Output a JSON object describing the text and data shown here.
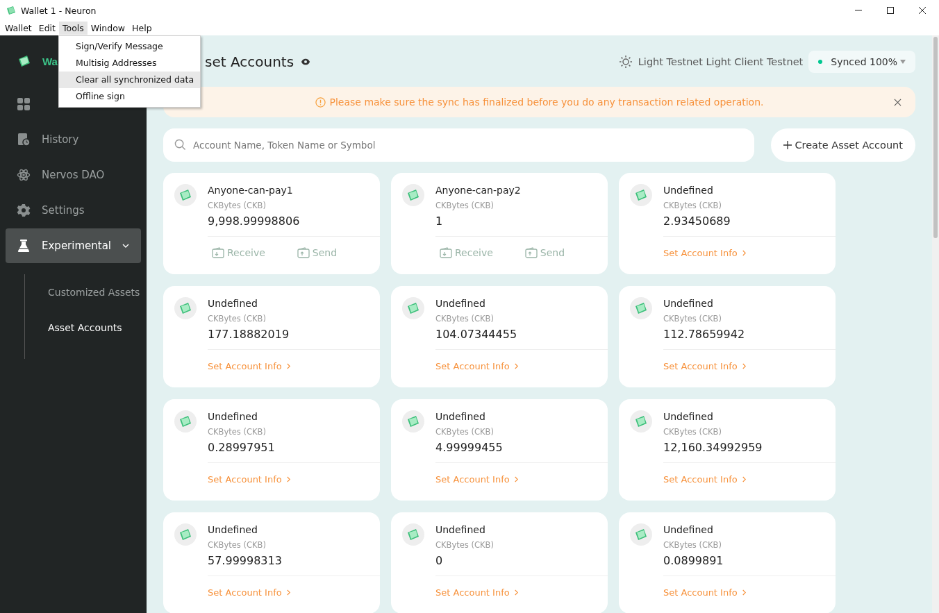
{
  "window": {
    "title": "Wallet 1 - Neuron"
  },
  "menu_bar": [
    {
      "label": "Wallet",
      "selected": false
    },
    {
      "label": "Edit",
      "selected": false
    },
    {
      "label": "Tools",
      "selected": true
    },
    {
      "label": "Window",
      "selected": false
    },
    {
      "label": "Help",
      "selected": false
    }
  ],
  "tools_menu": [
    {
      "label": "Sign/Verify Message",
      "selected": false
    },
    {
      "label": "Multisig Addresses",
      "selected": false
    },
    {
      "label": "Clear all synchronized data",
      "selected": true
    },
    {
      "label": "Offline sign",
      "selected": false
    }
  ],
  "sidebar": {
    "wallet_name": "Wa",
    "items": [
      {
        "selected": false
      },
      {
        "label": "History",
        "selected": false
      },
      {
        "label": "Nervos DAO",
        "selected": false
      },
      {
        "label": "Settings",
        "selected": false
      },
      {
        "label": "Experimental",
        "selected": true,
        "expanded": true,
        "children": [
          {
            "label": "Customized Assets",
            "selected": false
          },
          {
            "label": "Asset Accounts",
            "selected": true
          }
        ]
      }
    ]
  },
  "header": {
    "title": "set Accounts",
    "network": "Light Testnet Light Client Testnet",
    "sync": "Synced 100%"
  },
  "banner": {
    "message": "Please make sure the sync has finalized before you do any transaction related operation."
  },
  "search": {
    "placeholder": "Account Name, Token Name or Symbol"
  },
  "create_button": "Create Asset Account",
  "accounts": [
    {
      "kind": "acp",
      "name": "Anyone-can-pay1",
      "token": "CKBytes (CKB)",
      "balance": "9,998.99998806",
      "actions": [
        "Receive",
        "Send"
      ]
    },
    {
      "kind": "acp",
      "name": "Anyone-can-pay2",
      "token": "CKBytes (CKB)",
      "balance": "1",
      "actions": [
        "Receive",
        "Send"
      ]
    },
    {
      "kind": "plain",
      "name": "Undefined",
      "token": "CKBytes (CKB)",
      "balance": "2.93450689",
      "link": "Set Account Info"
    },
    {
      "kind": "plain",
      "name": "Undefined",
      "token": "CKBytes (CKB)",
      "balance": "177.18882019",
      "link": "Set Account Info"
    },
    {
      "kind": "plain",
      "name": "Undefined",
      "token": "CKBytes (CKB)",
      "balance": "104.07344455",
      "link": "Set Account Info"
    },
    {
      "kind": "plain",
      "name": "Undefined",
      "token": "CKBytes (CKB)",
      "balance": "112.78659942",
      "link": "Set Account Info"
    },
    {
      "kind": "plain",
      "name": "Undefined",
      "token": "CKBytes (CKB)",
      "balance": "0.28997951",
      "link": "Set Account Info"
    },
    {
      "kind": "plain",
      "name": "Undefined",
      "token": "CKBytes (CKB)",
      "balance": "4.99999455",
      "link": "Set Account Info"
    },
    {
      "kind": "plain",
      "name": "Undefined",
      "token": "CKBytes (CKB)",
      "balance": "12,160.34992959",
      "link": "Set Account Info"
    },
    {
      "kind": "plain",
      "name": "Undefined",
      "token": "CKBytes (CKB)",
      "balance": "57.99998313",
      "link": "Set Account Info"
    },
    {
      "kind": "plain",
      "name": "Undefined",
      "token": "CKBytes (CKB)",
      "balance": "0",
      "link": "Set Account Info"
    },
    {
      "kind": "plain",
      "name": "Undefined",
      "token": "CKBytes (CKB)",
      "balance": "0.0899891",
      "link": "Set Account Info"
    }
  ]
}
